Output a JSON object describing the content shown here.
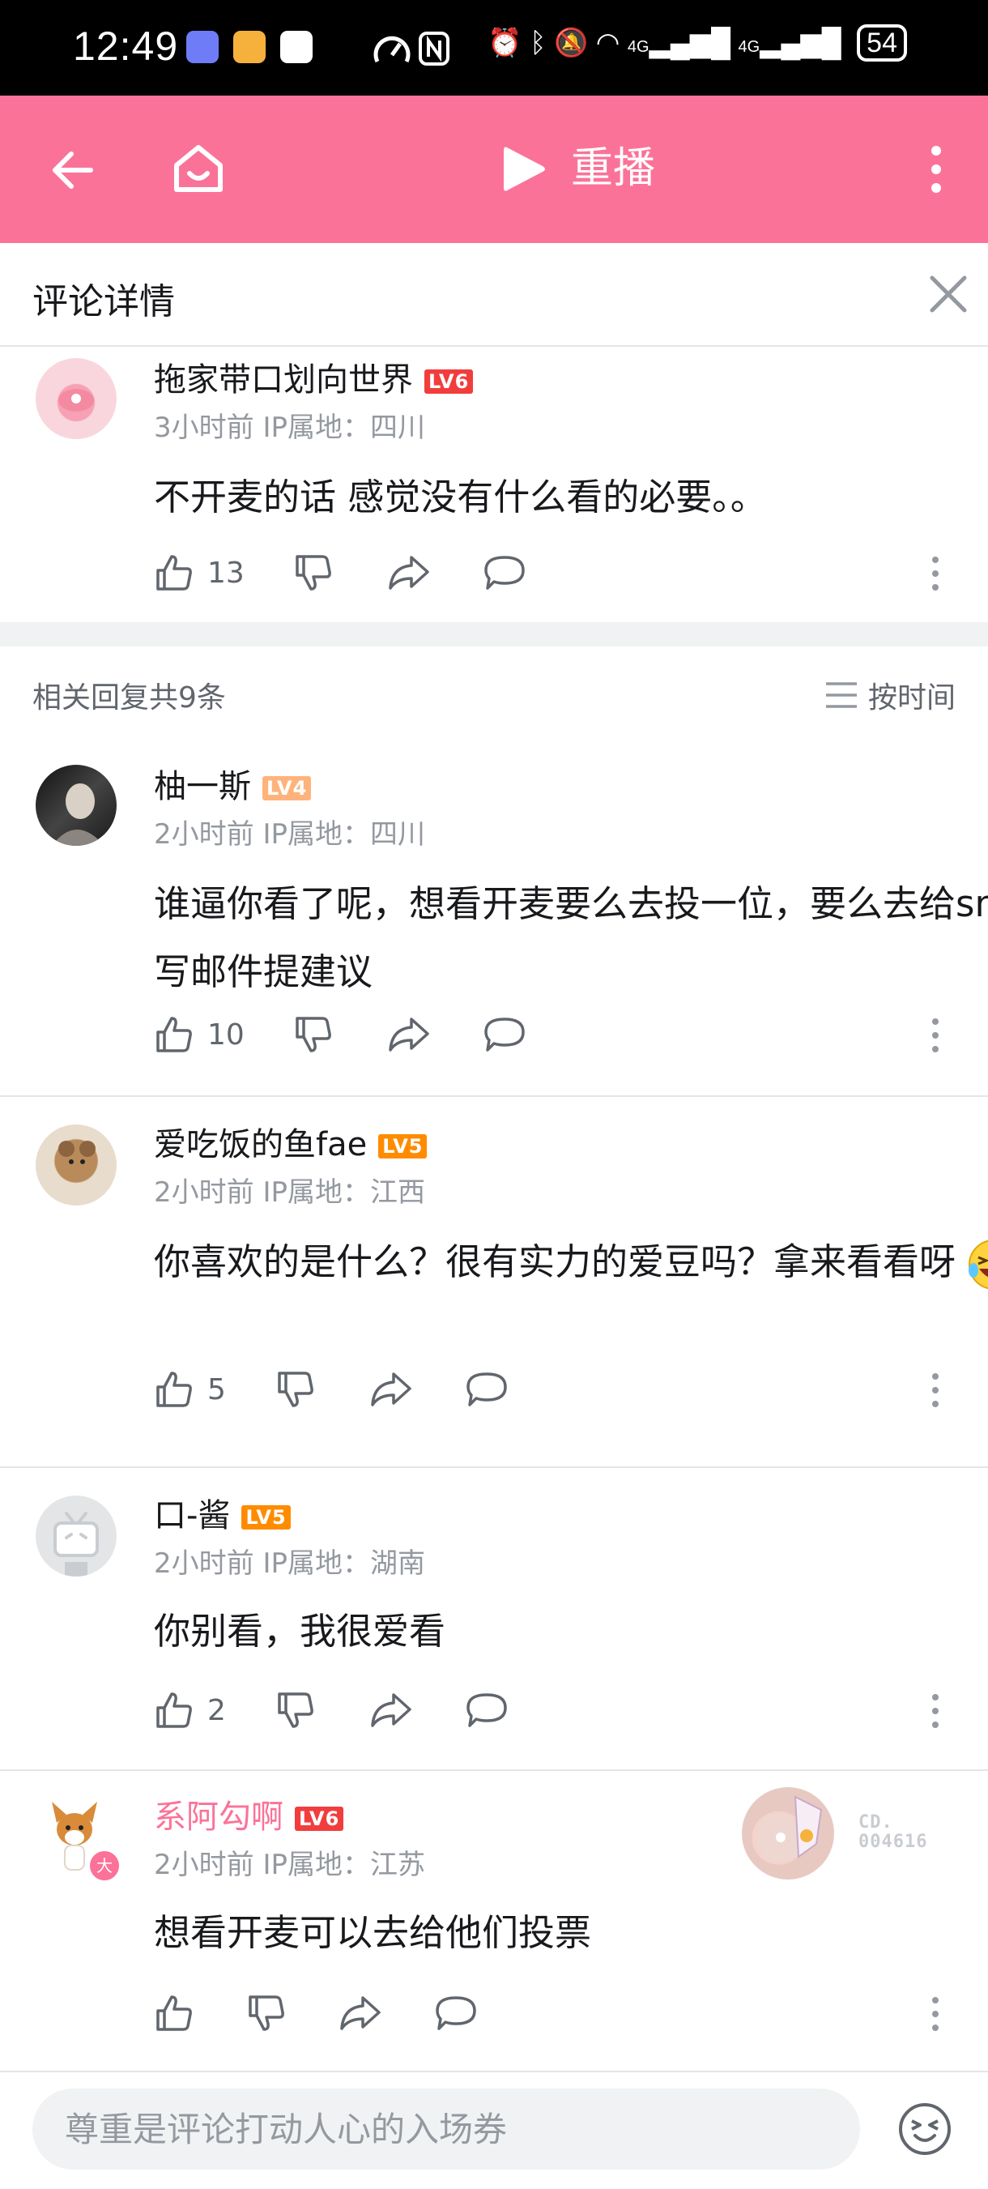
{
  "status_bar": {
    "time": "12:49",
    "network_1": "4G",
    "network_2": "4G",
    "battery": "54"
  },
  "nav": {
    "title": "重播"
  },
  "sheet": {
    "title": "评论详情"
  },
  "root_comment": {
    "username": "拖家带口划向世界",
    "level": "LV6",
    "meta": "3小时前 IP属地：四川",
    "content": "不开麦的话 感觉没有什么看的必要。。",
    "likes": "13"
  },
  "replies_header": {
    "count_label": "相关回复共9条",
    "sort_label": "按时间"
  },
  "replies": [
    {
      "username": "柚一斯",
      "level": "LV4",
      "meta": "2小时前 IP属地：四川",
      "content": "谁逼你看了呢，想看开麦要么去投一位，要么去给sm写邮件提建议",
      "likes": "10"
    },
    {
      "username": "爱吃饭的鱼fae",
      "level": "LV5",
      "meta": "2小时前 IP属地：江西",
      "content": "你喜欢的是什么？很有实力的爱豆吗？拿来看看呀",
      "likes": "5"
    },
    {
      "username": "口-酱",
      "level": "LV5",
      "meta": "2小时前 IP属地：湖南",
      "content": "你别看，我很爱看",
      "likes": "2"
    },
    {
      "username": "系阿勾啊",
      "level": "LV6",
      "meta": "2小时前 IP属地：江苏",
      "content": "想看开麦可以去给他们投票",
      "likes": "",
      "badge_line1": "CD.",
      "badge_line2": "004616",
      "vip_mark": "大"
    }
  ],
  "input": {
    "placeholder": "尊重是评论打动人心的入场券"
  },
  "colors": {
    "brand_pink": "#fb7299",
    "lv4": "#ffb37c",
    "lv5": "#ff8c00",
    "lv6": "#f23d3d"
  }
}
